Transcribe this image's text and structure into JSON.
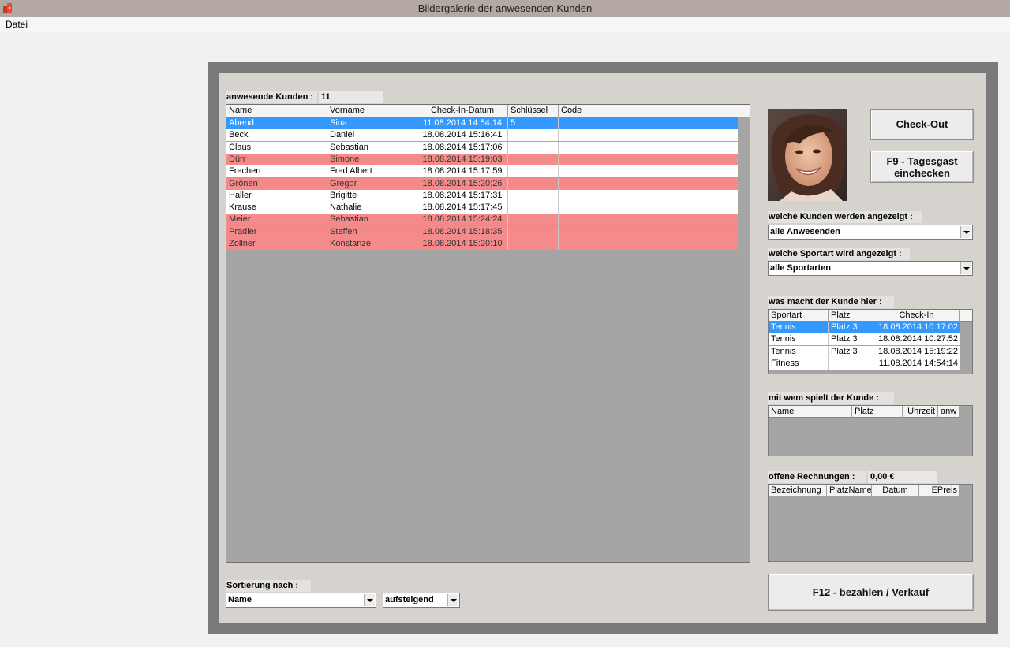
{
  "window": {
    "title": "Bildergalerie der anwesenden Kunden"
  },
  "menu": {
    "file_label": "Datei"
  },
  "present": {
    "label": "anwesende Kunden :",
    "count": "11"
  },
  "main_grid": {
    "columns": [
      "Name",
      "Vorname",
      "Check-In-Datum",
      "Schlüssel",
      "Code"
    ],
    "rows": [
      {
        "name": "Abend",
        "vorname": "Sina",
        "checkin": "11.08.2014 14:54:14",
        "key": "5",
        "code": "",
        "state": "selected"
      },
      {
        "name": "Beck",
        "vorname": "Daniel",
        "checkin": "18.08.2014 15:16:41",
        "key": "",
        "code": "",
        "state": "normal"
      },
      {
        "name": "Claus",
        "vorname": "Sebastian",
        "checkin": "18.08.2014 15:17:06",
        "key": "",
        "code": "",
        "state": "normal"
      },
      {
        "name": "Dürr",
        "vorname": "Simone",
        "checkin": "18.08.2014 15:19:03",
        "key": "",
        "code": "",
        "state": "red"
      },
      {
        "name": "Frechen",
        "vorname": "Fred Albert",
        "checkin": "18.08.2014 15:17:59",
        "key": "",
        "code": "",
        "state": "normal"
      },
      {
        "name": "Grönen",
        "vorname": "Gregor",
        "checkin": "18.08.2014 15:20:26",
        "key": "",
        "code": "",
        "state": "red"
      },
      {
        "name": "Haller",
        "vorname": "Brigitte",
        "checkin": "18.08.2014 15:17:31",
        "key": "",
        "code": "",
        "state": "normal"
      },
      {
        "name": "Krause",
        "vorname": "Nathalie",
        "checkin": "18.08.2014 15:17:45",
        "key": "",
        "code": "",
        "state": "normal"
      },
      {
        "name": "Meier",
        "vorname": "Sebastian",
        "checkin": "18.08.2014 15:24:24",
        "key": "",
        "code": "",
        "state": "red"
      },
      {
        "name": "Pradler",
        "vorname": "Steffen",
        "checkin": "18.08.2014 15:18:35",
        "key": "",
        "code": "",
        "state": "red"
      },
      {
        "name": "Zollner",
        "vorname": "Konstanze",
        "checkin": "18.08.2014 15:20:10",
        "key": "",
        "code": "",
        "state": "red"
      }
    ]
  },
  "buttons": {
    "checkout": "Check-Out",
    "tagesgast_line1": "F9 - Tagesgast",
    "tagesgast_line2": "einchecken",
    "pay": "F12 - bezahlen / Verkauf"
  },
  "filter_customers": {
    "label": "welche Kunden werden angezeigt :",
    "value": "alle Anwesenden"
  },
  "filter_sport": {
    "label": "welche Sportart wird angezeigt :",
    "value": "alle Sportarten"
  },
  "activity": {
    "label": "was macht der Kunde hier :",
    "columns": [
      "Sportart",
      "Platz",
      "Check-In"
    ],
    "rows": [
      {
        "sport": "Tennis",
        "platz": "Platz 3",
        "checkin": "18.08.2014 10:17:02",
        "state": "selected"
      },
      {
        "sport": "Tennis",
        "platz": "Platz 3",
        "checkin": "18.08.2014 10:27:52",
        "state": "normal"
      },
      {
        "sport": "Tennis",
        "platz": "Platz 3",
        "checkin": "18.08.2014 15:19:22",
        "state": "normal"
      },
      {
        "sport": "Fitness",
        "platz": "",
        "checkin": "11.08.2014 14:54:14",
        "state": "normal"
      }
    ]
  },
  "partners": {
    "label": "mit wem spielt der Kunde :",
    "columns": [
      "Name",
      "Platz",
      "Uhrzeit",
      "anw"
    ]
  },
  "invoices": {
    "label": "offene Rechnungen :",
    "amount": "0,00 €",
    "columns": [
      "Bezeichnung",
      "PlatzName",
      "Datum",
      "EPreis"
    ]
  },
  "sorting": {
    "label": "Sortierung nach :",
    "field": "Name",
    "direction": "aufsteigend"
  },
  "colors": {
    "selected": "#3399ff",
    "highlight_red": "#f58a8a",
    "frame": "#7a7a7a",
    "panel": "#d6d3ce"
  }
}
